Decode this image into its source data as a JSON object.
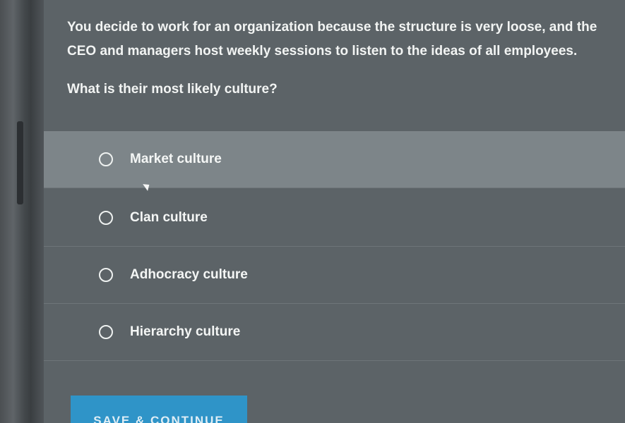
{
  "quiz": {
    "question": "You decide to work for an organization because the structure is very loose, and the CEO and managers host weekly sessions to listen to the ideas of all employees.",
    "prompt": "What is their most likely culture?",
    "options": [
      {
        "label": "Market culture",
        "selected": false
      },
      {
        "label": "Clan culture",
        "selected": false
      },
      {
        "label": "Adhocracy culture",
        "selected": false
      },
      {
        "label": "Hierarchy culture",
        "selected": false
      }
    ],
    "save_button": "SAVE & CONTINUE"
  },
  "colors": {
    "panel": "#5c6367",
    "hover_row": "#7d8589",
    "button": "#2f94c8",
    "text": "#f2f4f3"
  },
  "icons": {
    "radio": "radio-unchecked-icon",
    "cursor": "mouse-pointer-icon"
  }
}
